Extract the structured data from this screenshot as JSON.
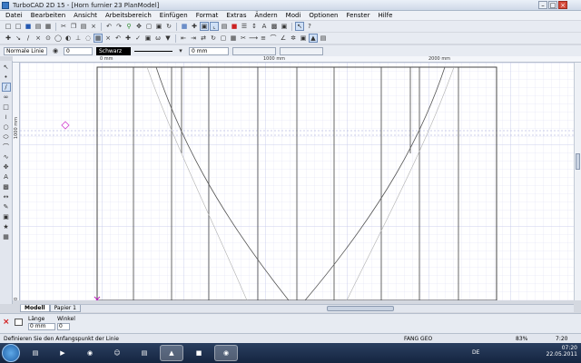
{
  "window": {
    "title": "TurboCAD 2D 15 - [Horn furnier 23 PlanModel]"
  },
  "menu": [
    "Datei",
    "Bearbeiten",
    "Ansicht",
    "Arbeitsbereich",
    "Einfügen",
    "Format",
    "Extras",
    "Ändern",
    "Modi",
    "Optionen",
    "Fenster",
    "Hilfe"
  ],
  "properties": {
    "linetype": "Normale Linie",
    "layer_value": "0",
    "color": "Schwarz",
    "width": "0 mm"
  },
  "rulers": {
    "h_ticks": [
      "0 mm",
      "1000 mm",
      "2000 mm"
    ],
    "v_ticks": [
      "1000 mm",
      "0 mm"
    ]
  },
  "tabs": [
    "Modell",
    "Papier 1"
  ],
  "input": {
    "length_label": "Länge",
    "length_value": "0 mm",
    "angle_label": "Winkel",
    "angle_value": "0"
  },
  "status": {
    "prompt": "Definieren Sie den Anfangspunkt der Linie",
    "mode": "FANG  GEO",
    "zoom": "83%",
    "time": "7:20"
  },
  "taskbar": {
    "lang": "DE",
    "clock": "07:20",
    "date": "22.05.2011"
  }
}
